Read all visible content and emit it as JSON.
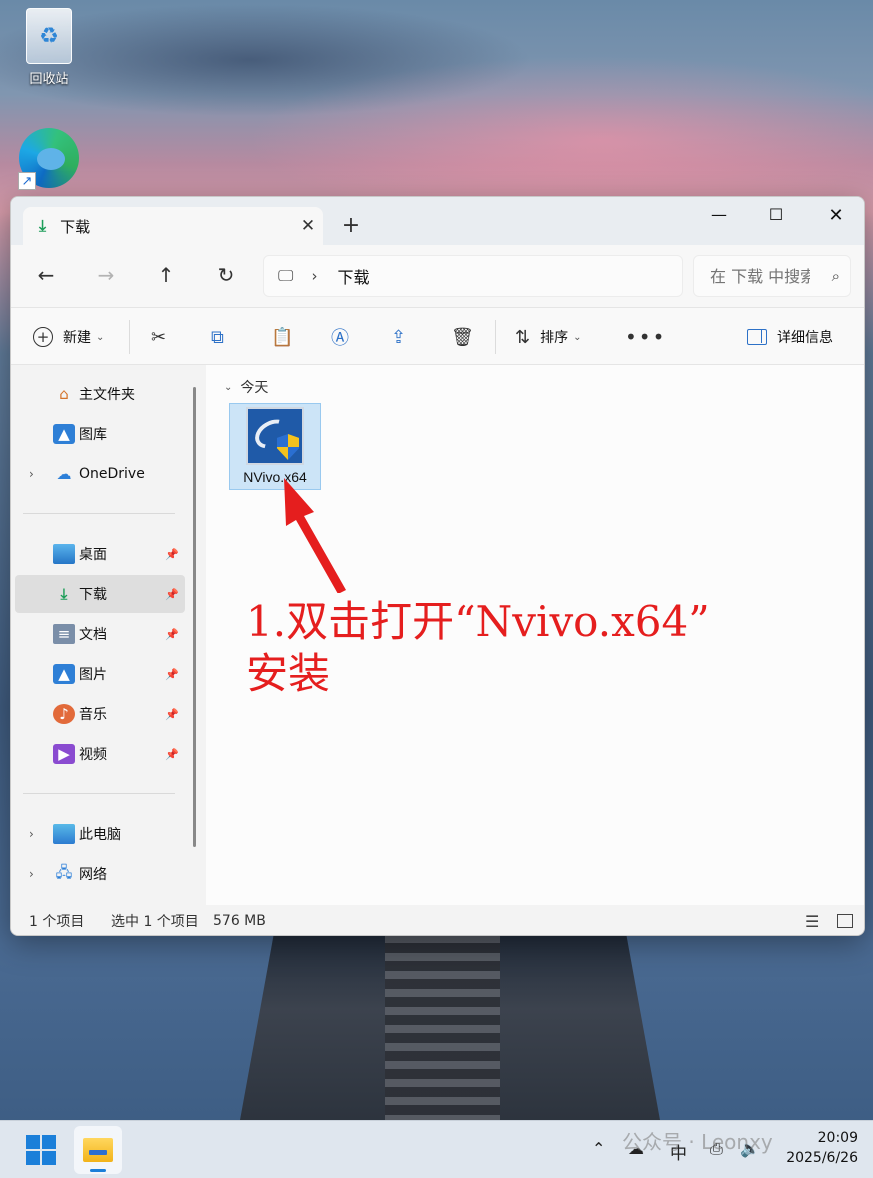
{
  "desktop": {
    "recycle_bin_label": "回收站"
  },
  "window": {
    "tab_title": "下载",
    "minimize_glyph": "—",
    "maximize_glyph": "☐",
    "close_glyph": "✕",
    "new_tab_glyph": "+"
  },
  "navigation": {
    "breadcrumb": "下载",
    "search_placeholder": "在 下载 中搜索"
  },
  "toolbar": {
    "new_label": "新建",
    "sort_label": "排序",
    "details_label": "详细信息"
  },
  "sidebar": {
    "items": [
      {
        "label": "主文件夹",
        "icon": "home-icon"
      },
      {
        "label": "图库",
        "icon": "gallery-icon"
      },
      {
        "label": "OneDrive",
        "icon": "cloud-icon"
      },
      {
        "label": "桌面",
        "icon": "desktop-icon"
      },
      {
        "label": "下载",
        "icon": "download-icon"
      },
      {
        "label": "文档",
        "icon": "document-icon"
      },
      {
        "label": "图片",
        "icon": "picture-icon"
      },
      {
        "label": "音乐",
        "icon": "music-icon"
      },
      {
        "label": "视频",
        "icon": "video-icon"
      },
      {
        "label": "此电脑",
        "icon": "pc-icon"
      },
      {
        "label": "网络",
        "icon": "network-icon"
      }
    ]
  },
  "content": {
    "group_label": "今天",
    "files": [
      {
        "name": "NVivo.x64",
        "icon": "nvivo-installer-icon"
      }
    ]
  },
  "status": {
    "count": "1 个项目",
    "selected": "选中 1 个项目",
    "size": "576 MB"
  },
  "annotation": {
    "line1": "1.双击打开“Nvivo.x64”",
    "line2": "安装",
    "color": "#e51e1e"
  },
  "taskbar": {
    "ime": "中",
    "watermark": "公众号 · Leonxy",
    "time": "20:09",
    "date": "2025/6/26"
  }
}
